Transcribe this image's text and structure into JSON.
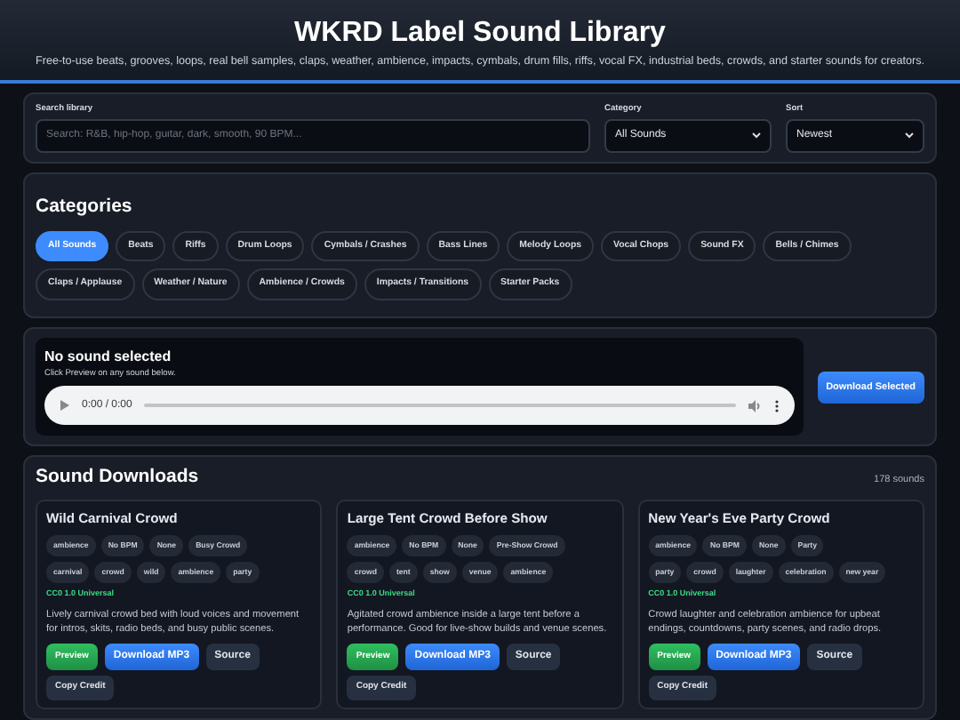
{
  "header": {
    "title": "WKRD Label Sound Library",
    "subtitle": "Free-to-use beats, grooves, loops, real bell samples, claps, weather, ambience, impacts, cymbals, drum fills, riffs, vocal FX, industrial beds, crowds, and starter sounds for creators."
  },
  "filters": {
    "search": {
      "label": "Search library",
      "placeholder": "Search: R&B, hip-hop, guitar, dark, smooth, 90 BPM..."
    },
    "category": {
      "label": "Category",
      "value": "All Sounds"
    },
    "sort": {
      "label": "Sort",
      "value": "Newest"
    }
  },
  "categories": {
    "title": "Categories",
    "items": [
      {
        "label": "All Sounds",
        "selected": true
      },
      {
        "label": "Beats",
        "selected": false
      },
      {
        "label": "Riffs",
        "selected": false
      },
      {
        "label": "Drum Loops",
        "selected": false
      },
      {
        "label": "Cymbals / Crashes",
        "selected": false
      },
      {
        "label": "Bass Lines",
        "selected": false
      },
      {
        "label": "Melody Loops",
        "selected": false
      },
      {
        "label": "Vocal Chops",
        "selected": false
      },
      {
        "label": "Sound FX",
        "selected": false
      },
      {
        "label": "Bells / Chimes",
        "selected": false
      },
      {
        "label": "Claps / Applause",
        "selected": false
      },
      {
        "label": "Weather / Nature",
        "selected": false
      },
      {
        "label": "Ambience / Crowds",
        "selected": false
      },
      {
        "label": "Impacts / Transitions",
        "selected": false
      },
      {
        "label": "Starter Packs",
        "selected": false
      }
    ]
  },
  "player": {
    "title": "No sound selected",
    "hint": "Click Preview on any sound below.",
    "time": "0:00 / 0:00",
    "download_button": "Download Selected"
  },
  "downloads": {
    "title": "Sound Downloads",
    "count": "178 sounds",
    "cards": [
      {
        "title": "Wild Carnival Crowd",
        "meta": [
          "ambience",
          "No BPM",
          "None",
          "Busy Crowd"
        ],
        "tags": [
          "carnival",
          "crowd",
          "wild",
          "ambience",
          "party"
        ],
        "license": "CC0 1.0 Universal",
        "description": "Lively carnival crowd bed with loud voices and movement for intros, skits, radio beds, and busy public scenes.",
        "buttons": {
          "preview": "Preview",
          "download": "Download MP3",
          "source": "Source",
          "credit": "Copy Credit"
        }
      },
      {
        "title": "Large Tent Crowd Before Show",
        "meta": [
          "ambience",
          "No BPM",
          "None",
          "Pre-Show Crowd"
        ],
        "tags": [
          "crowd",
          "tent",
          "show",
          "venue",
          "ambience"
        ],
        "license": "CC0 1.0 Universal",
        "description": "Agitated crowd ambience inside a large tent before a performance. Good for live-show builds and venue scenes.",
        "buttons": {
          "preview": "Preview",
          "download": "Download MP3",
          "source": "Source",
          "credit": "Copy Credit"
        }
      },
      {
        "title": "New Year's Eve Party Crowd",
        "meta": [
          "ambience",
          "No BPM",
          "None",
          "Party"
        ],
        "tags": [
          "party",
          "crowd",
          "laughter",
          "celebration",
          "new year"
        ],
        "license": "CC0 1.0 Universal",
        "description": "Crowd laughter and celebration ambience for upbeat endings, countdowns, party scenes, and radio drops.",
        "buttons": {
          "preview": "Preview",
          "download": "Download MP3",
          "source": "Source",
          "credit": "Copy Credit"
        }
      }
    ]
  }
}
